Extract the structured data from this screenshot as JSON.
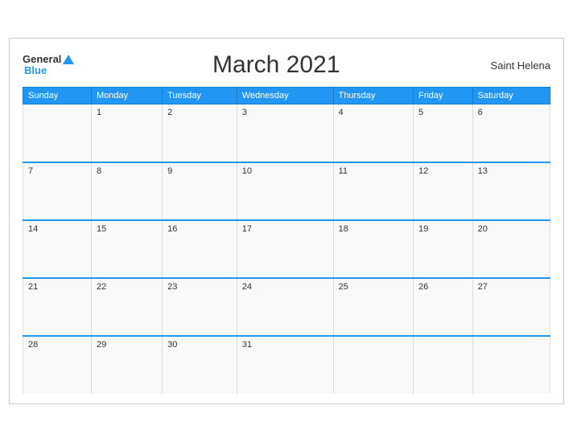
{
  "header": {
    "logo_general": "General",
    "logo_blue": "Blue",
    "title": "March 2021",
    "region": "Saint Helena"
  },
  "weekdays": [
    "Sunday",
    "Monday",
    "Tuesday",
    "Wednesday",
    "Thursday",
    "Friday",
    "Saturday"
  ],
  "weeks": [
    [
      {
        "day": "",
        "empty": true
      },
      {
        "day": "1"
      },
      {
        "day": "2"
      },
      {
        "day": "3"
      },
      {
        "day": "4"
      },
      {
        "day": "5"
      },
      {
        "day": "6"
      }
    ],
    [
      {
        "day": "7"
      },
      {
        "day": "8"
      },
      {
        "day": "9"
      },
      {
        "day": "10"
      },
      {
        "day": "11"
      },
      {
        "day": "12"
      },
      {
        "day": "13"
      }
    ],
    [
      {
        "day": "14"
      },
      {
        "day": "15"
      },
      {
        "day": "16"
      },
      {
        "day": "17"
      },
      {
        "day": "18"
      },
      {
        "day": "19"
      },
      {
        "day": "20"
      }
    ],
    [
      {
        "day": "21"
      },
      {
        "day": "22"
      },
      {
        "day": "23"
      },
      {
        "day": "24"
      },
      {
        "day": "25"
      },
      {
        "day": "26"
      },
      {
        "day": "27"
      }
    ],
    [
      {
        "day": "28"
      },
      {
        "day": "29"
      },
      {
        "day": "30"
      },
      {
        "day": "31"
      },
      {
        "day": ""
      },
      {
        "day": ""
      },
      {
        "day": ""
      }
    ]
  ],
  "colors": {
    "header_bg": "#2196f3",
    "border_top": "#2196f3",
    "cell_bg": "#f9f9f9"
  }
}
